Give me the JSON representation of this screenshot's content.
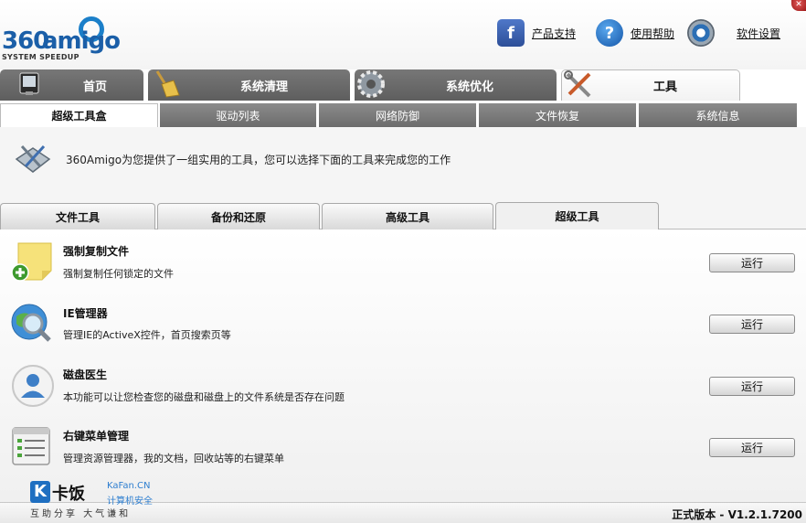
{
  "app": {
    "logo_number": "360",
    "logo_name": "amigo",
    "logo_tagline": "SYSTEM SPEEDUP"
  },
  "header_links": [
    {
      "label": "产品支持",
      "icon": "facebook-icon"
    },
    {
      "label": "使用帮助",
      "icon": "help-icon"
    },
    {
      "label": "软件设置",
      "icon": "gear-icon"
    }
  ],
  "main_tabs": [
    {
      "label": "首页",
      "icon": "monitor-icon",
      "active": false
    },
    {
      "label": "系统清理",
      "icon": "broom-icon",
      "active": false
    },
    {
      "label": "系统优化",
      "icon": "gear-icon",
      "active": false
    },
    {
      "label": "工具",
      "icon": "tools-icon",
      "active": true
    }
  ],
  "sub_tabs": [
    {
      "label": "超级工具盒",
      "active": true
    },
    {
      "label": "驱动列表",
      "active": false
    },
    {
      "label": "网络防御",
      "active": false
    },
    {
      "label": "文件恢复",
      "active": false
    },
    {
      "label": "系统信息",
      "active": false
    }
  ],
  "intro_text": "360Amigo为您提供了一组实用的工具，您可以选择下面的工具来完成您的工作",
  "tool_tabs": [
    {
      "label": "文件工具",
      "active": false
    },
    {
      "label": "备份和还原",
      "active": false
    },
    {
      "label": "高级工具",
      "active": false
    },
    {
      "label": "超级工具",
      "active": true
    }
  ],
  "tools": [
    {
      "title": "强制复制文件",
      "description": "强制复制任何锁定的文件",
      "button": "运行",
      "icon": "sticky-note-add-icon"
    },
    {
      "title": "IE管理器",
      "description": "管理IE的ActiveX控件，首页搜索页等",
      "button": "运行",
      "icon": "globe-search-icon"
    },
    {
      "title": "磁盘医生",
      "description": "本功能可以让您检查您的磁盘和磁盘上的文件系统是否存在问题",
      "button": "运行",
      "icon": "user-avatar-icon"
    },
    {
      "title": "右键菜单管理",
      "description": "管理资源管理器，我的文档，回收站等的右键菜单",
      "button": "运行",
      "icon": "context-menu-list-icon"
    }
  ],
  "footer": {
    "brand_name": "卡饭",
    "brand_en": "KaFan.CN",
    "brand_cn": "计算机安全",
    "slogan": "互助分享 大气谦和",
    "version": "正式版本 - V1.2.1.7200"
  },
  "colors": {
    "brand_blue": "#1b5fa8",
    "tab_dark": "#6c6c6c"
  }
}
